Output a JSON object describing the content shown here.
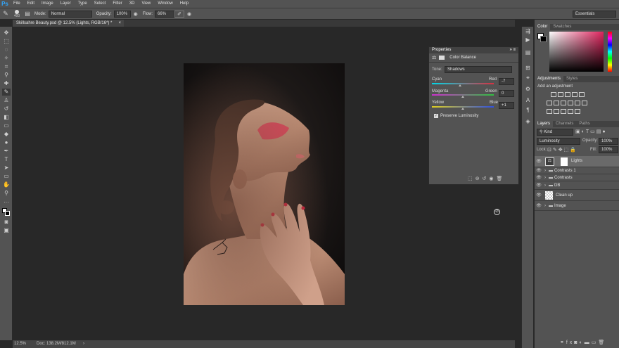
{
  "app": {
    "logo": "Ps"
  },
  "menu": [
    "File",
    "Edit",
    "Image",
    "Layer",
    "Type",
    "Select",
    "Filter",
    "3D",
    "View",
    "Window",
    "Help"
  ],
  "options": {
    "brush_size": "400",
    "mode_label": "Mode:",
    "mode_value": "Normal",
    "opacity_label": "Opacity:",
    "opacity_value": "100%",
    "flow_label": "Flow:",
    "flow_value": "66%",
    "workspace": "Essentials"
  },
  "document": {
    "tab_title": "Skillsahre Beauty.psd @ 12.5% (Lights, RGB/16*) *",
    "tab_close": "×"
  },
  "status": {
    "zoom": "12.5%",
    "doc": "Doc: 138.2M/812.1M",
    "arrow": "›"
  },
  "properties": {
    "title": "Properties",
    "panel_name": "Color Balance",
    "tone_label": "Tone:",
    "tone_value": "Shadows",
    "sliders": [
      {
        "left": "Cyan",
        "right": "Red",
        "value": "-7",
        "level": 0.46
      },
      {
        "left": "Magenta",
        "right": "Green",
        "value": "0",
        "level": 0.5
      },
      {
        "left": "Yellow",
        "right": "Blue",
        "value": "+1",
        "level": 0.505
      }
    ],
    "preserve_label": "Preserve Luminosity",
    "preserve_checked": true
  },
  "color_panel": {
    "tabs": [
      "Color",
      "Swatches"
    ],
    "fg": "#ffffff",
    "bg": "#000000",
    "accent": "#e0245e"
  },
  "adjustments": {
    "tabs": [
      "Adjustments",
      "Styles"
    ],
    "hint": "Add an adjustment"
  },
  "layers_panel": {
    "tabs": [
      "Layers",
      "Channels",
      "Paths"
    ],
    "kind": "Kind",
    "blend": "Luminosity",
    "opacity_label": "Opacity:",
    "opacity_value": "100%",
    "lock_label": "Lock:",
    "fill_label": "Fill:",
    "fill_value": "100%",
    "layers": [
      {
        "name": "Lights",
        "type": "adjustment",
        "selected": true
      },
      {
        "name": "Contrasts 1",
        "type": "group"
      },
      {
        "name": "Contrasts",
        "type": "group"
      },
      {
        "name": "DB",
        "type": "group"
      },
      {
        "name": "Clean up",
        "type": "pixel"
      },
      {
        "name": "Image",
        "type": "group"
      }
    ]
  }
}
